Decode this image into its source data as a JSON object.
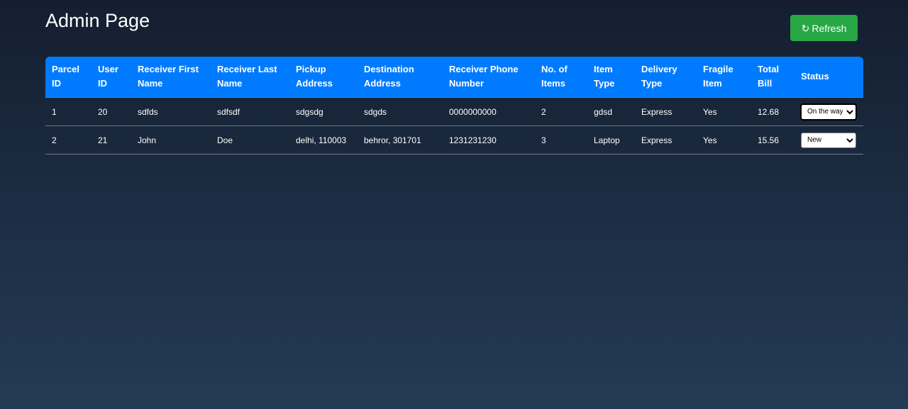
{
  "page": {
    "title": "Admin Page"
  },
  "toolbar": {
    "refresh_icon": "↻",
    "refresh_label": "Refresh",
    "refresh_color": "#28a745"
  },
  "table": {
    "header_color": "#007bff",
    "columns": [
      "Parcel ID",
      "User ID",
      "Receiver First Name",
      "Receiver Last Name",
      "Pickup Address",
      "Destination Address",
      "Receiver Phone Number",
      "No. of Items",
      "Item Type",
      "Delivery Type",
      "Fragile Item",
      "Total Bill",
      "Status"
    ],
    "rows": [
      {
        "parcel_id": "1",
        "user_id": "20",
        "first_name": "sdfds",
        "last_name": "sdfsdf",
        "pickup": "sdgsdg",
        "destination": "sdgds",
        "phone": "0000000000",
        "items": "2",
        "item_type": "gdsd",
        "delivery": "Express",
        "fragile": "Yes",
        "bill": "12.68",
        "status": "On the way"
      },
      {
        "parcel_id": "2",
        "user_id": "21",
        "first_name": "John",
        "last_name": "Doe",
        "pickup": "delhi, 110003",
        "destination": "behror, 301701",
        "phone": "1231231230",
        "items": "3",
        "item_type": "Laptop",
        "delivery": "Express",
        "fragile": "Yes",
        "bill": "15.56",
        "status": "New"
      }
    ]
  }
}
